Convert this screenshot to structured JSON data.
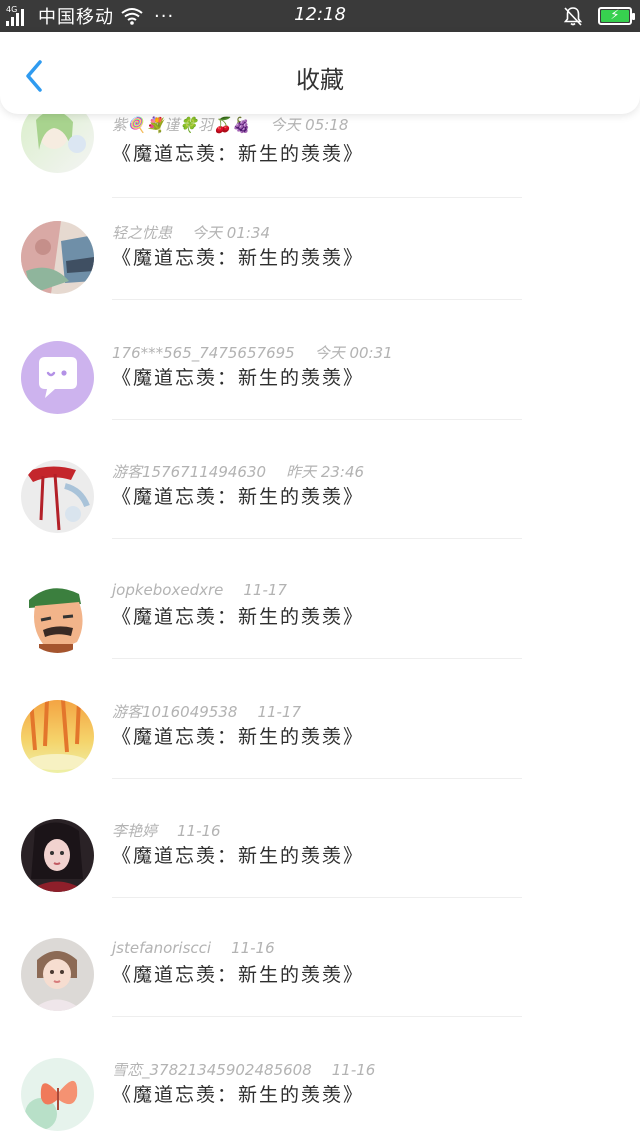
{
  "status_bar": {
    "network": "4G",
    "carrier": "中国移动",
    "more": "···",
    "time": "12:18"
  },
  "header": {
    "title": "收藏"
  },
  "icons": {
    "back": "back-chevron-icon",
    "wifi": "wifi-icon",
    "bell_off": "bell-off-icon",
    "battery": "battery-charging-icon"
  },
  "colors": {
    "accent": "#2f9bf0",
    "battery_green": "#37d04f"
  },
  "items": [
    {
      "user": "紫🍭💐谨🍀羽🍒🍇",
      "time": "今天 05:18",
      "title": "《魔道忘羡：新生的羡羡》"
    },
    {
      "user": "轻之忧患",
      "time": "今天 01:34",
      "title": "《魔道忘羡：新生的羡羡》"
    },
    {
      "user": "176***565_7475657695",
      "time": "今天 00:31",
      "title": "《魔道忘羡：新生的羡羡》"
    },
    {
      "user": "游客1576711494630",
      "time": "昨天 23:46",
      "title": "《魔道忘羡：新生的羡羡》"
    },
    {
      "user": "jopkeboxedxre",
      "time": "11-17",
      "title": "《魔道忘羡：新生的羡羡》"
    },
    {
      "user": "游客1016049538",
      "time": "11-17",
      "title": "《魔道忘羡：新生的羡羡》"
    },
    {
      "user": "李艳婷",
      "time": "11-16",
      "title": "《魔道忘羡：新生的羡羡》"
    },
    {
      "user": "jstefanoriscci",
      "time": "11-16",
      "title": "《魔道忘羡：新生的羡羡》"
    },
    {
      "user": "雪恋_37821345902485608",
      "time": "11-16",
      "title": "《魔道忘羡：新生的羡羡》"
    }
  ]
}
